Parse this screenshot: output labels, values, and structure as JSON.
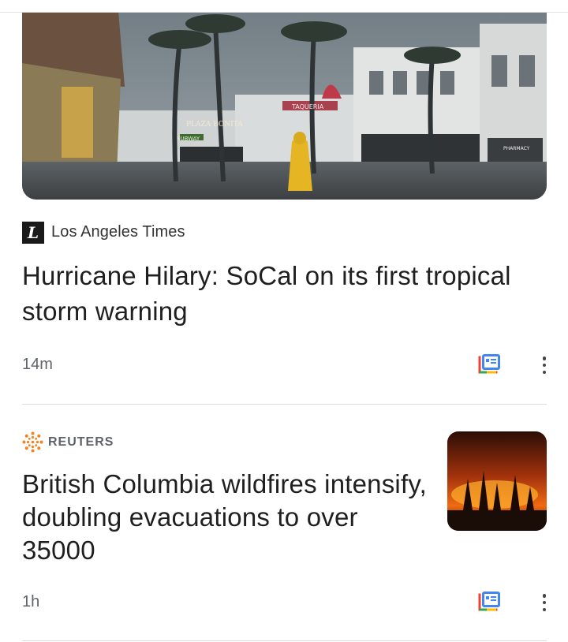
{
  "articles": [
    {
      "source": "Los Angeles Times",
      "source_logo_letter": "L",
      "headline": "Hurricane Hilary: SoCal on its first tropical storm warning",
      "time": "14m",
      "image_signs": [
        "PLAZA BONITA",
        "TAQUERIA",
        "SUBWAY",
        "PHARMACY"
      ]
    },
    {
      "source": "REUTERS",
      "headline": "British Columbia wildfires intensify, doubling evacuations to over 35000",
      "time": "1h"
    }
  ],
  "icons": {
    "full_coverage": "full-coverage-icon",
    "more": "more-vert-icon"
  },
  "colors": {
    "google_blue": "#4285f4",
    "google_red": "#ea4335",
    "google_yellow": "#fbbc04",
    "google_green": "#34a853",
    "reuters_orange": "#f58220"
  }
}
